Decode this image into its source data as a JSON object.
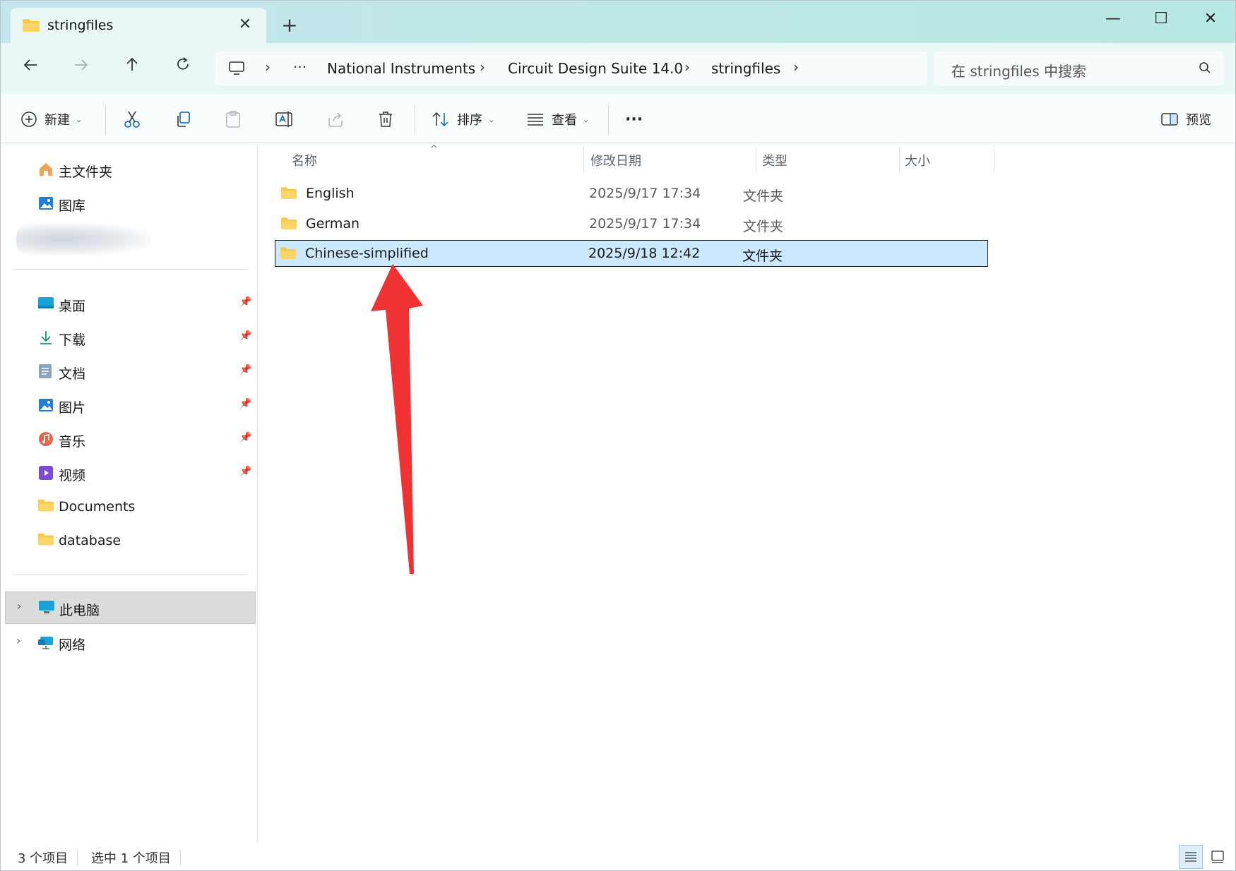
{
  "window": {
    "tab_title": "stringfiles",
    "tab_close": "✕",
    "new_tab": "+",
    "minimize": "—",
    "maximize": "☐",
    "close": "✕"
  },
  "nav": {
    "breadcrumb": [
      "National Instruments",
      "Circuit Design Suite 14.0",
      "stringfiles"
    ],
    "overflow": "···",
    "search_placeholder": "在 stringfiles 中搜索"
  },
  "toolbar": {
    "new_label": "新建",
    "sort_label": "排序",
    "view_label": "查看",
    "more": "···",
    "preview_label": "预览"
  },
  "sidebar": {
    "top_items": [
      {
        "label": "主文件夹",
        "icon": "home-icon"
      },
      {
        "label": "图库",
        "icon": "gallery-icon"
      }
    ],
    "pinned_items": [
      {
        "label": "桌面",
        "icon": "desktop-icon"
      },
      {
        "label": "下载",
        "icon": "download-icon"
      },
      {
        "label": "文档",
        "icon": "documents-icon"
      },
      {
        "label": "图片",
        "icon": "pictures-icon"
      },
      {
        "label": "音乐",
        "icon": "music-icon"
      },
      {
        "label": "视频",
        "icon": "videos-icon"
      },
      {
        "label": "Documents",
        "icon": "folder-icon"
      },
      {
        "label": "database",
        "icon": "folder-icon"
      }
    ],
    "bottom_items": [
      {
        "label": "此电脑",
        "icon": "this-pc-icon"
      },
      {
        "label": "网络",
        "icon": "network-icon"
      }
    ]
  },
  "filelist": {
    "columns": [
      "名称",
      "修改日期",
      "类型",
      "大小"
    ],
    "rows": [
      {
        "name": "English",
        "date": "2025/9/17 17:34",
        "type": "文件夹",
        "size": ""
      },
      {
        "name": "German",
        "date": "2025/9/17 17:34",
        "type": "文件夹",
        "size": ""
      },
      {
        "name": "Chinese-simplified",
        "date": "2025/9/18 12:42",
        "type": "文件夹",
        "size": ""
      }
    ],
    "selected_index": 2
  },
  "status": {
    "item_count": "3 个项目",
    "selected_count": "选中 1 个项目"
  },
  "colors": {
    "accent": "#0067c0",
    "selection": "#cce8ff",
    "annotation_arrow": "#f03232",
    "folder": "#f8c94a"
  }
}
